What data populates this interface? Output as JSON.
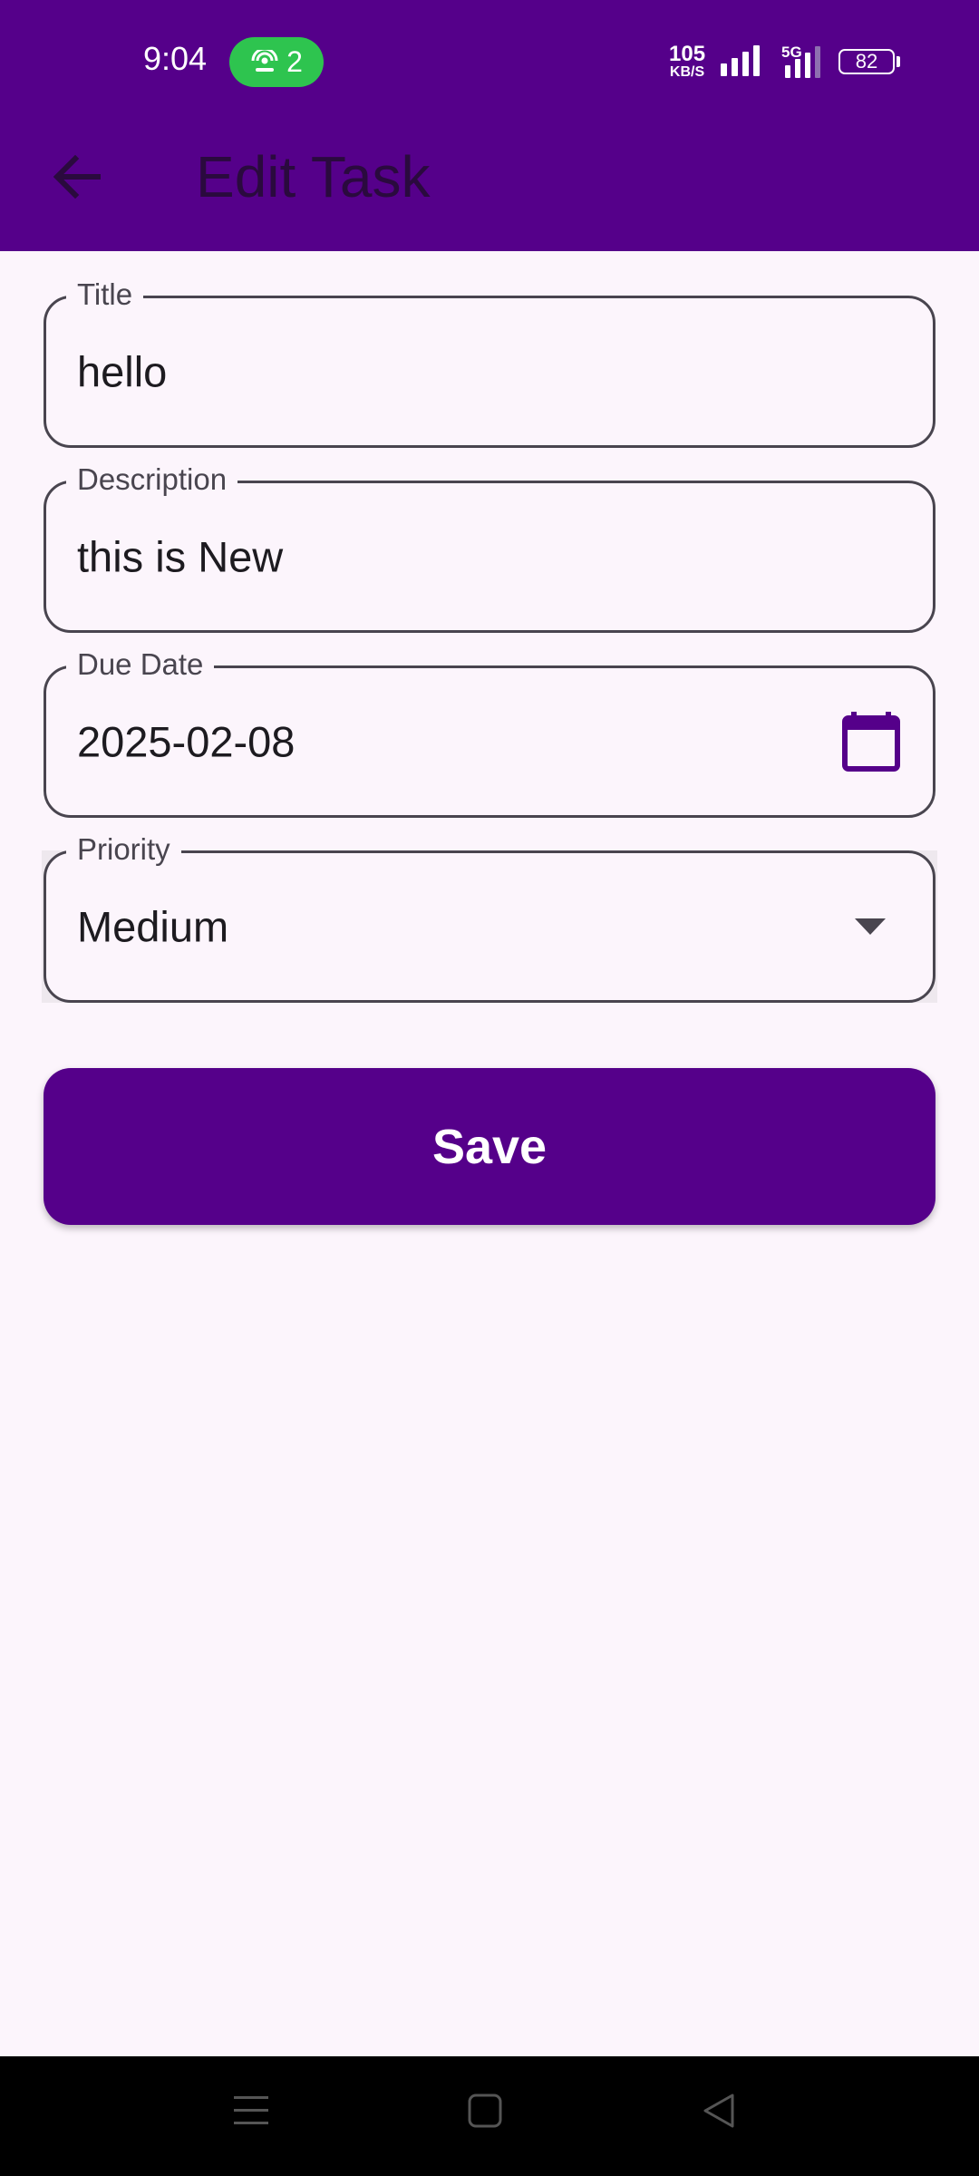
{
  "status_bar": {
    "time": "9:04",
    "hotspot_count": "2",
    "net_speed_value": "105",
    "net_speed_unit": "KB/S",
    "network_type": "5G",
    "battery": "82"
  },
  "app_bar": {
    "title": "Edit Task",
    "back_icon": "arrow-back-icon",
    "background_color": "#55008A"
  },
  "form": {
    "title": {
      "label": "Title",
      "value": "hello"
    },
    "description": {
      "label": "Description",
      "value": "this is New"
    },
    "due_date": {
      "label": "Due Date",
      "value": "2025-02-08",
      "icon": "calendar-icon"
    },
    "priority": {
      "label": "Priority",
      "value": "Medium",
      "icon": "dropdown-arrow-icon"
    }
  },
  "save_button": {
    "label": "Save",
    "color": "#55008A"
  },
  "nav_bar": {
    "icons": [
      "menu-icon",
      "home-icon",
      "back-icon"
    ]
  }
}
